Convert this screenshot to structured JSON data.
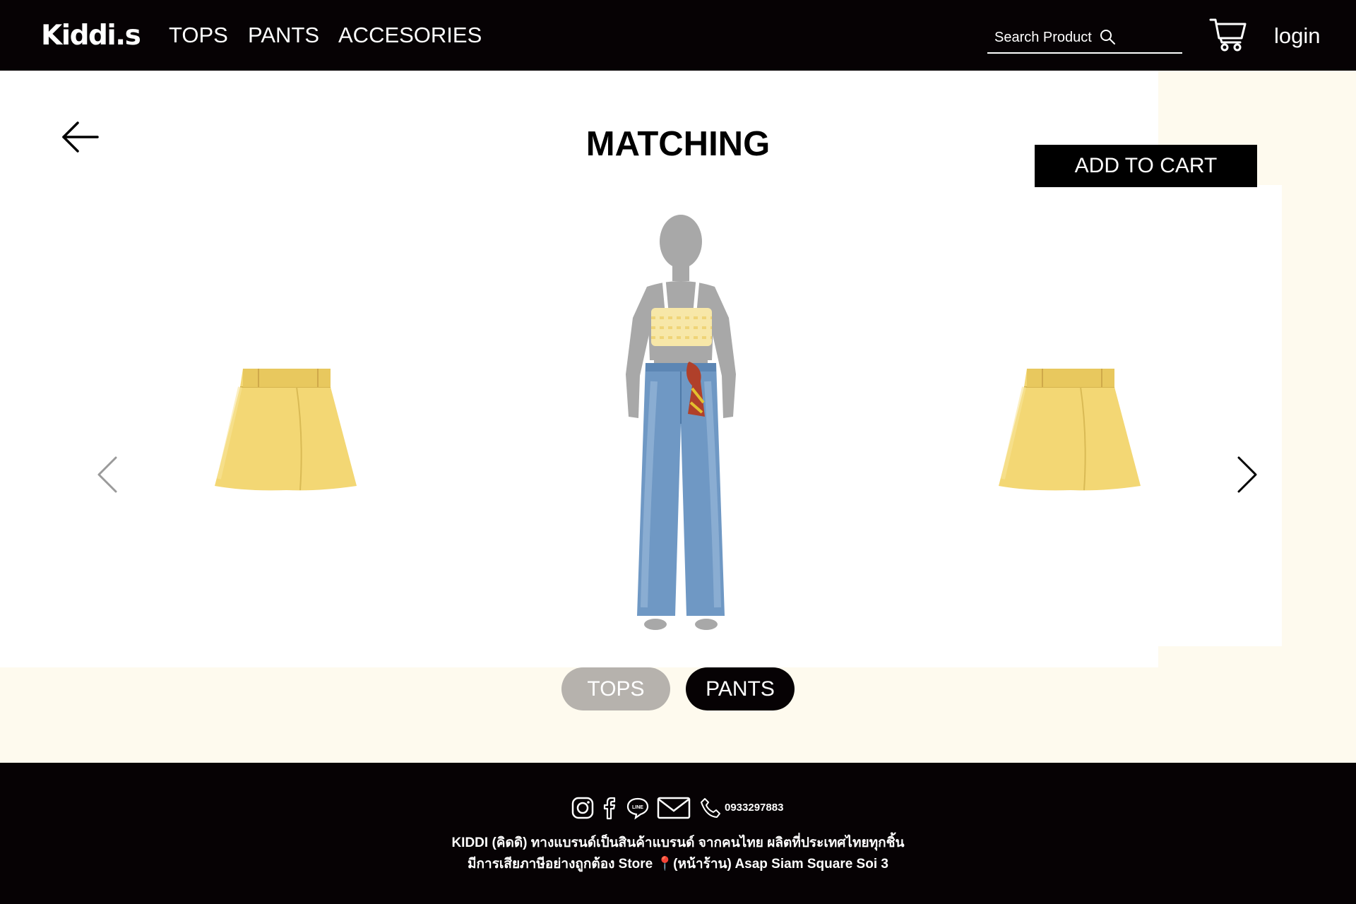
{
  "header": {
    "logo": "Kiddi.s",
    "nav": [
      {
        "label": "TOPS"
      },
      {
        "label": "PANTS"
      },
      {
        "label": "ACCESORIES"
      }
    ],
    "search": {
      "placeholder": "Search Product",
      "icon": "search-icon"
    },
    "cart_icon": "cart-icon",
    "login_label": "login"
  },
  "main": {
    "title": "MATCHING",
    "back_icon": "arrow-left-icon",
    "add_to_cart_label": "ADD TO CART",
    "carousel": {
      "prev_icon": "chevron-left-icon",
      "next_icon": "chevron-right-icon",
      "items": [
        {
          "name": "yellow-wrap-skirt",
          "color": "#f3d774"
        },
        {
          "name": "yellow-wrap-skirt",
          "color": "#f3d774"
        }
      ]
    },
    "mannequin": {
      "top": {
        "name": "yellow-houndstooth-crop-top",
        "color": "#f7e7a8"
      },
      "bottom": {
        "name": "wide-leg-jeans",
        "color": "#6f98c4"
      },
      "accessory": {
        "name": "printed-scarf-belt",
        "color": "#b0402a"
      }
    },
    "category_toggle": [
      {
        "label": "TOPS",
        "active": false
      },
      {
        "label": "PANTS",
        "active": true
      }
    ]
  },
  "footer": {
    "social_icons": [
      "instagram-icon",
      "facebook-icon",
      "line-icon",
      "mail-icon",
      "phone-icon"
    ],
    "phone": "0933297883",
    "line1": "KIDDI (คิดดิ) ทางแบรนด์เป็นสินค้าแบรนด์ จากคนไทย ผลิตที่ประเทศไทยทุกชิ้น",
    "line2": "มีการเสียภาษีอย่างถูกต้อง Store 📍(หน้าร้าน) Asap Siam Square Soi 3"
  },
  "colors": {
    "header_bg": "#060204",
    "page_bg": "#fefaee",
    "panel_bg": "#ffffff",
    "toggle_inactive": "#b6b2ad",
    "toggle_active": "#060204"
  }
}
